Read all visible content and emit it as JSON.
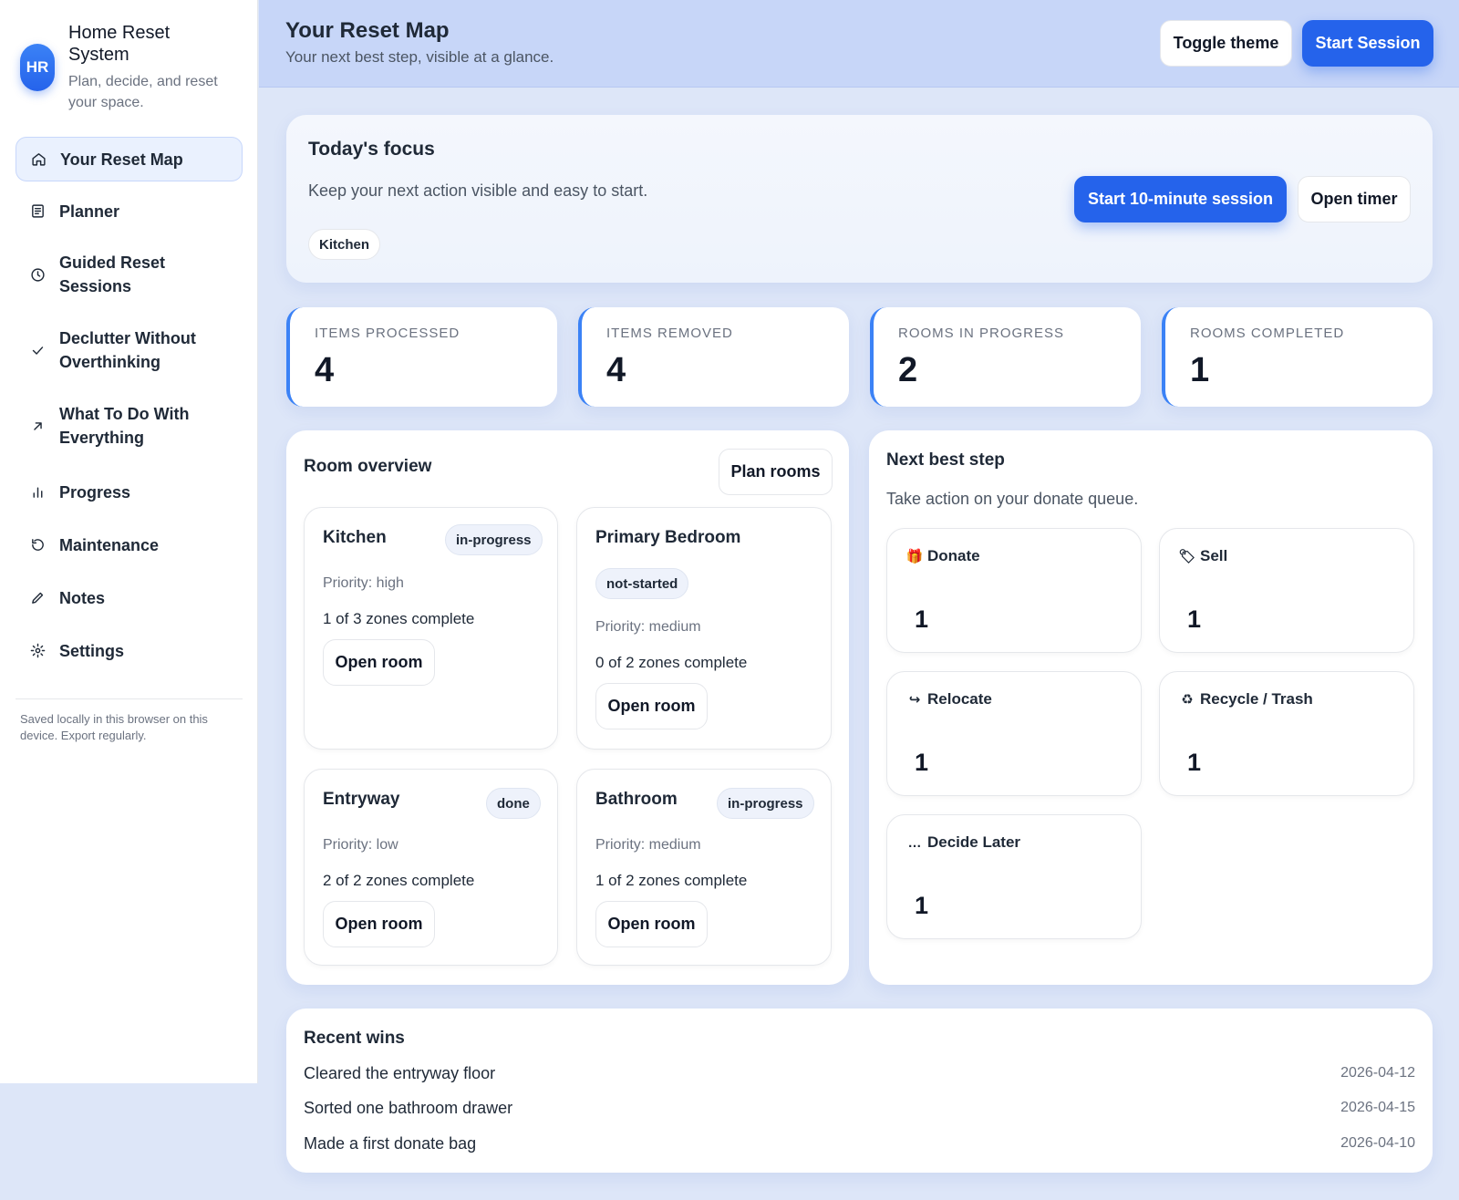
{
  "brand": {
    "initials": "HR",
    "title": "Home Reset System",
    "subtitle": "Plan, decide, and reset your space."
  },
  "nav": {
    "items": [
      {
        "label": "Your Reset Map",
        "icon": "home-icon",
        "active": true
      },
      {
        "label": "Planner",
        "icon": "list-icon"
      },
      {
        "label": "Guided Reset Sessions",
        "icon": "clock-icon"
      },
      {
        "label": "Declutter Without Overthinking",
        "icon": "check-icon"
      },
      {
        "label": "What To Do With Everything",
        "icon": "arrow-up-right-icon"
      },
      {
        "label": "Progress",
        "icon": "bar-chart-icon"
      },
      {
        "label": "Maintenance",
        "icon": "refresh-icon"
      },
      {
        "label": "Notes",
        "icon": "pencil-icon"
      },
      {
        "label": "Settings",
        "icon": "gear-icon"
      }
    ],
    "footer_note": "Saved locally in this browser on this device. Export regularly."
  },
  "header": {
    "title": "Your Reset Map",
    "subtitle": "Your next best step, visible at a glance.",
    "toggle_theme": "Toggle theme",
    "start_session": "Start Session"
  },
  "focus": {
    "title": "Today's focus",
    "subtitle": "Keep your next action visible and easy to start.",
    "chip": "Kitchen",
    "start_btn": "Start 10-minute session",
    "timer_btn": "Open timer"
  },
  "stats": [
    {
      "label": "ITEMS PROCESSED",
      "value": "4"
    },
    {
      "label": "ITEMS REMOVED",
      "value": "4"
    },
    {
      "label": "ROOMS IN PROGRESS",
      "value": "2"
    },
    {
      "label": "ROOMS COMPLETED",
      "value": "1"
    }
  ],
  "rooms": {
    "title": "Room overview",
    "plan_btn": "Plan rooms",
    "items": [
      {
        "name": "Kitchen",
        "status": "in-progress",
        "priority": "Priority: high",
        "zones": "1 of 3 zones complete",
        "open": "Open room"
      },
      {
        "name": "Primary Bedroom",
        "status": "not-started",
        "priority": "Priority: medium",
        "zones": "0 of 2 zones complete",
        "open": "Open room"
      },
      {
        "name": "Entryway",
        "status": "done",
        "priority": "Priority: low",
        "zones": "2 of 2 zones complete",
        "open": "Open room"
      },
      {
        "name": "Bathroom",
        "status": "in-progress",
        "priority": "Priority: medium",
        "zones": "1 of 2 zones complete",
        "open": "Open room"
      }
    ]
  },
  "next_step": {
    "title": "Next best step",
    "subtitle": "Take action on your donate queue.",
    "queues": [
      {
        "icon": "🎁",
        "label": "Donate",
        "count": "1"
      },
      {
        "icon": "🏷",
        "label": "Sell",
        "count": "1"
      },
      {
        "icon": "↪",
        "label": "Relocate",
        "count": "1"
      },
      {
        "icon": "♻",
        "label": "Recycle / Trash",
        "count": "1"
      },
      {
        "icon": "…",
        "label": "Decide Later",
        "count": "1"
      }
    ]
  },
  "wins": {
    "title": "Recent wins",
    "items": [
      {
        "text": "Cleared the entryway floor",
        "date": "2026-04-12"
      },
      {
        "text": "Sorted one bathroom drawer",
        "date": "2026-04-15"
      },
      {
        "text": "Made a first donate bag",
        "date": "2026-04-10"
      }
    ]
  }
}
